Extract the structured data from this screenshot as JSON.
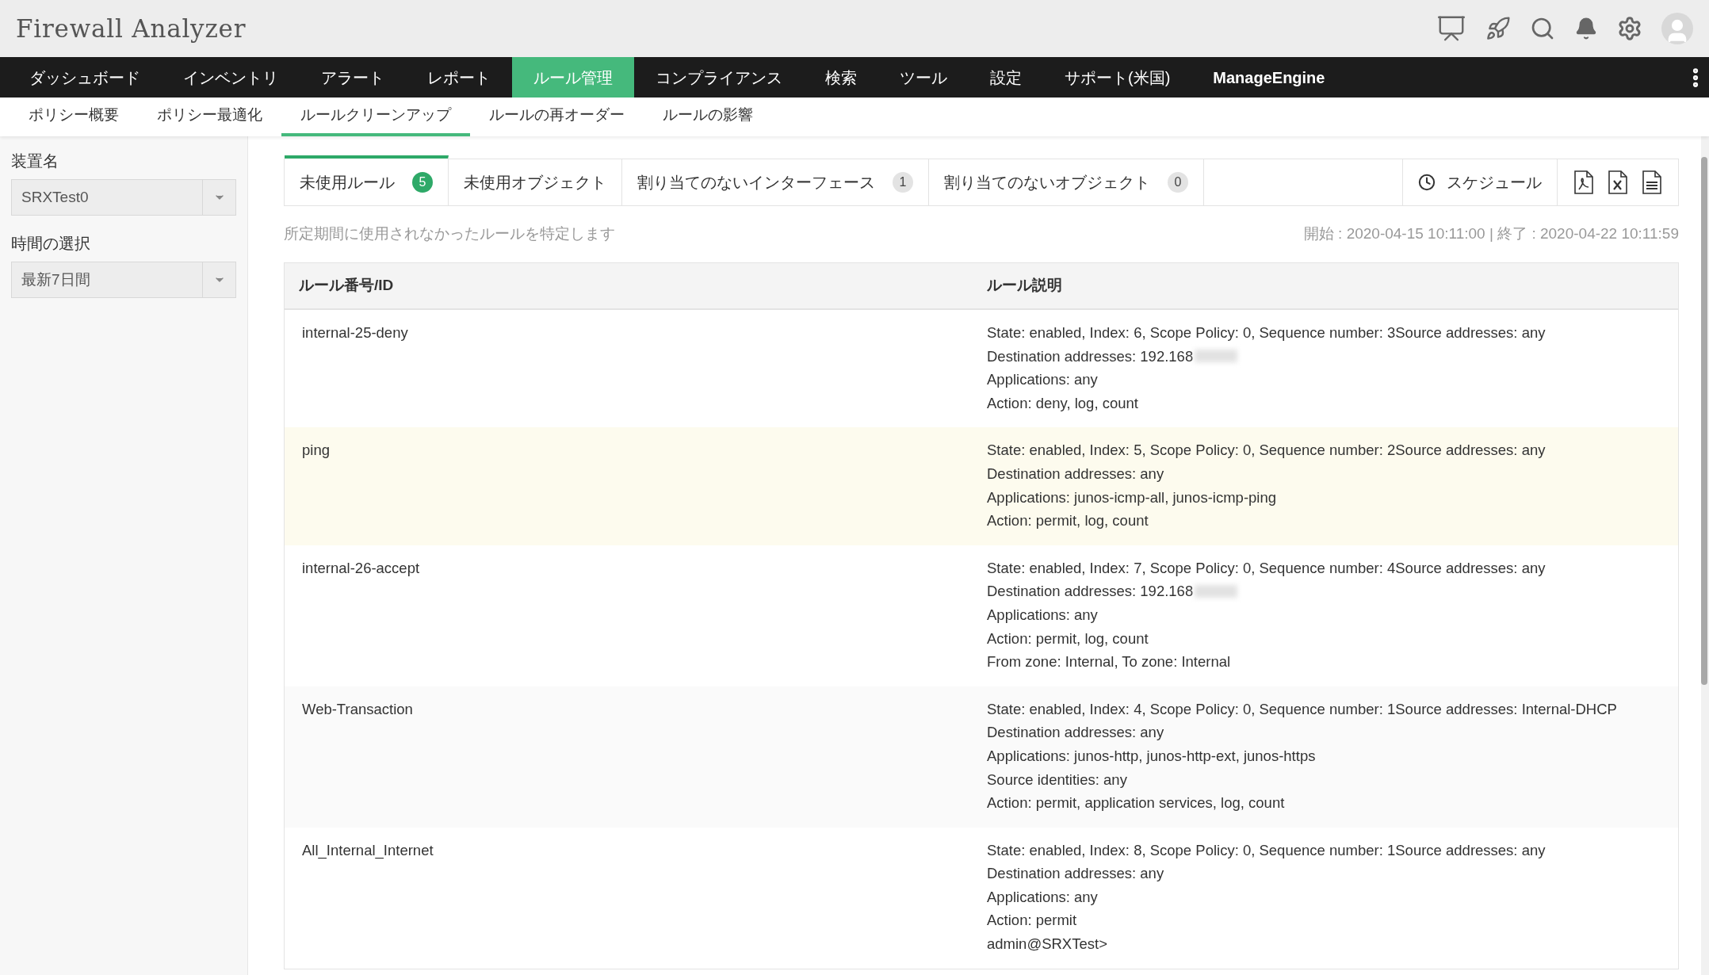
{
  "header": {
    "title": "Firewall Analyzer"
  },
  "nav": [
    {
      "label": "ダッシュボード",
      "selected": false
    },
    {
      "label": "インベントリ",
      "selected": false
    },
    {
      "label": "アラート",
      "selected": false
    },
    {
      "label": "レポート",
      "selected": false
    },
    {
      "label": "ルール管理",
      "selected": true
    },
    {
      "label": "コンプライアンス",
      "selected": false
    },
    {
      "label": "検索",
      "selected": false
    },
    {
      "label": "ツール",
      "selected": false
    },
    {
      "label": "設定",
      "selected": false
    },
    {
      "label": "サポート(米国)",
      "selected": false
    },
    {
      "label": "ManageEngine",
      "selected": false
    }
  ],
  "subnav": [
    {
      "label": "ポリシー概要",
      "selected": false
    },
    {
      "label": "ポリシー最適化",
      "selected": false
    },
    {
      "label": "ルールクリーンアップ",
      "selected": true
    },
    {
      "label": "ルールの再オーダー",
      "selected": false
    },
    {
      "label": "ルールの影響",
      "selected": false
    }
  ],
  "sidebar": {
    "fields": [
      {
        "label": "装置名",
        "value": "SRXTest0"
      },
      {
        "label": "時間の選択",
        "value": "最新7日間"
      }
    ]
  },
  "tabs": [
    {
      "label": "未使用ルール",
      "count": "5",
      "selected": true
    },
    {
      "label": "未使用オブジェクト",
      "selected": false
    },
    {
      "label": "割り当てのないインターフェース",
      "count": "1",
      "selected": false
    },
    {
      "label": "割り当てのないオブジェクト",
      "count": "0",
      "selected": false
    }
  ],
  "schedule_button": "スケジュール",
  "description": "所定期間に使用されなかったルールを特定します",
  "period": "開始 : 2020-04-15 10:11:00 | 終了 : 2020-04-22 10:11:59",
  "table": {
    "columns": [
      "ルール番号/ID",
      "ルール説明"
    ],
    "rows": [
      {
        "id": "internal-25-deny",
        "highlighted": false,
        "description": [
          {
            "text": "State: enabled, Index: 6, Scope Policy: 0, Sequence number: 3Source addresses: any"
          },
          {
            "text": "Destination addresses: 192.168",
            "redacted": true
          },
          {
            "text": "Applications: any"
          },
          {
            "text": "Action: deny, log, count"
          }
        ]
      },
      {
        "id": "ping",
        "highlighted": true,
        "description": [
          {
            "text": "State: enabled, Index: 5, Scope Policy: 0, Sequence number: 2Source addresses: any"
          },
          {
            "text": "Destination addresses: any"
          },
          {
            "text": "Applications: junos-icmp-all, junos-icmp-ping"
          },
          {
            "text": "Action: permit, log, count"
          }
        ]
      },
      {
        "id": "internal-26-accept",
        "highlighted": false,
        "description": [
          {
            "text": "State: enabled, Index: 7, Scope Policy: 0, Sequence number: 4Source addresses: any"
          },
          {
            "text": "Destination addresses: 192.168",
            "redacted": true
          },
          {
            "text": "Applications: any"
          },
          {
            "text": "Action: permit, log, count"
          },
          {
            "text": "From zone: Internal, To zone: Internal"
          }
        ]
      },
      {
        "id": "Web-Transaction",
        "highlighted": false,
        "description": [
          {
            "text": "State: enabled, Index: 4, Scope Policy: 0, Sequence number: 1Source addresses: Internal-DHCP"
          },
          {
            "text": "Destination addresses: any"
          },
          {
            "text": "Applications: junos-http, junos-http-ext, junos-https"
          },
          {
            "text": "Source identities: any"
          },
          {
            "text": "Action: permit, application services, log, count"
          }
        ]
      },
      {
        "id": "All_Internal_Internet",
        "highlighted": false,
        "description": [
          {
            "text": "State: enabled, Index: 8, Scope Policy: 0, Sequence number: 1Source addresses: any"
          },
          {
            "text": "Destination addresses: any"
          },
          {
            "text": "Applications: any"
          },
          {
            "text": "Action: permit"
          },
          {
            "text": "admin@SRXTest>"
          }
        ]
      }
    ]
  }
}
